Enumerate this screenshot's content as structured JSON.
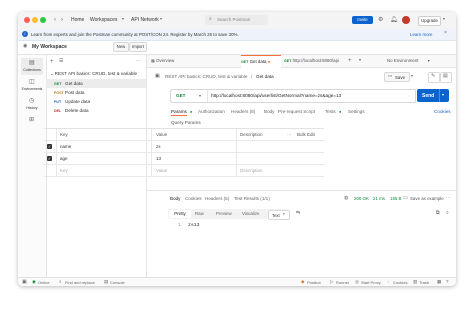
{
  "titlebar": {
    "home": "Home",
    "workspaces": "Workspaces",
    "api_network": "API Network",
    "search_placeholder": "Search Postman",
    "invite": "Invite",
    "upgrade": "Upgrade"
  },
  "banner": {
    "text": "Learn from experts and join the Postman community at POST/CON 24. Register by March 26 to save 30%.",
    "learn_more": "Learn more"
  },
  "workspace": {
    "name": "My Workspace",
    "new_label": "New",
    "import_label": "Import"
  },
  "tabs": {
    "overview": "Overview",
    "active_method": "GET",
    "active_label": "Get data",
    "second_method": "GET",
    "second_label": "http://localhost:8080/api",
    "environment": "No Environment"
  },
  "rail": {
    "items": [
      "Collections",
      "Environments",
      "History"
    ]
  },
  "sidebar": {
    "collection": "REST API basics: CRUD, test & variable",
    "requests": [
      {
        "method": "GET",
        "label": "Get data",
        "color": "#0f8a3c"
      },
      {
        "method": "POST",
        "label": "Post data",
        "color": "#b5770e"
      },
      {
        "method": "PUT",
        "label": "Update data",
        "color": "#2262c6"
      },
      {
        "method": "DEL",
        "label": "Delete data",
        "color": "#c12d2d"
      }
    ]
  },
  "request": {
    "breadcrumb_collection": "REST API basics: CRUD, test & variable",
    "breadcrumb_separator": "/",
    "title": "Get data",
    "save": "Save",
    "method": "GET",
    "url": "http://localhost:8080/api/userlist/GetNormal?name=zs&age=13",
    "send": "Send",
    "subtabs": [
      "Params",
      "Authorization",
      "Headers (8)",
      "Body",
      "Pre-request Script",
      "Tests",
      "Settings"
    ],
    "cookies": "Cookies",
    "query_params_label": "Query Params",
    "table_headers": {
      "key": "Key",
      "value": "Value",
      "description": "Description",
      "bulk_edit": "Bulk Edit"
    },
    "params": [
      {
        "key": "name",
        "value": "zs"
      },
      {
        "key": "age",
        "value": "13"
      }
    ],
    "empty_key": "Key",
    "empty_value": "Value",
    "empty_description": "Description"
  },
  "response": {
    "tabs": [
      "Body",
      "Cookies",
      "Headers (5)",
      "Test Results (1/1)"
    ],
    "status": "200 OK",
    "time": "21 ms",
    "size": "155 B",
    "save_example": "Save as example",
    "views": [
      "Pretty",
      "Raw",
      "Preview",
      "Visualize"
    ],
    "format": "Text",
    "line_number": "1",
    "body": "zs13"
  },
  "statusbar": {
    "online": "Online",
    "find_replace": "Find and replace",
    "console": "Console",
    "postbot": "Postbot",
    "runner": "Runner",
    "start_proxy": "Start Proxy",
    "cookies": "Cookies",
    "trash": "Trash"
  },
  "colors": {
    "accent_orange": "#ff6c37",
    "send_blue": "#0b63ce",
    "get_green": "#0f8a3c",
    "status_green": "#0a8a3a"
  }
}
